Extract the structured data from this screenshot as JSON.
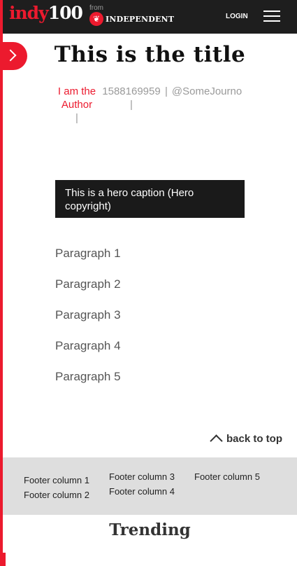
{
  "header": {
    "logo_indy": "indy",
    "logo_100": "100",
    "from_label": "from",
    "partner_name": "INDEPENDENT",
    "login_label": "LOGIN"
  },
  "article": {
    "title": "This is the title",
    "author": "I am the Author",
    "separator": "|",
    "timestamp": "1588169959",
    "twitter": "@SomeJourno",
    "hero_caption": "This is a hero caption (Hero copyright)",
    "paragraphs": [
      "Paragraph 1",
      "Paragraph 2",
      "Paragraph 3",
      "Paragraph 4",
      "Paragraph 5"
    ]
  },
  "back_to_top": "back to top",
  "footer": {
    "columns": [
      "Footer column 1",
      "Footer column 2",
      "Footer column 3",
      "Footer column 4",
      "Footer column 5"
    ]
  },
  "trending_title": "Trending",
  "colors": {
    "brand_red": "#ec1a2e",
    "header_bg": "#1e1e1e",
    "footer_bg": "#dedede"
  },
  "icons": {
    "menu": "hamburger-menu-icon",
    "side_toggle": "chevron-right-icon",
    "back_to_top": "chevron-up-icon",
    "partner_logo": "eagle-logo-icon"
  }
}
